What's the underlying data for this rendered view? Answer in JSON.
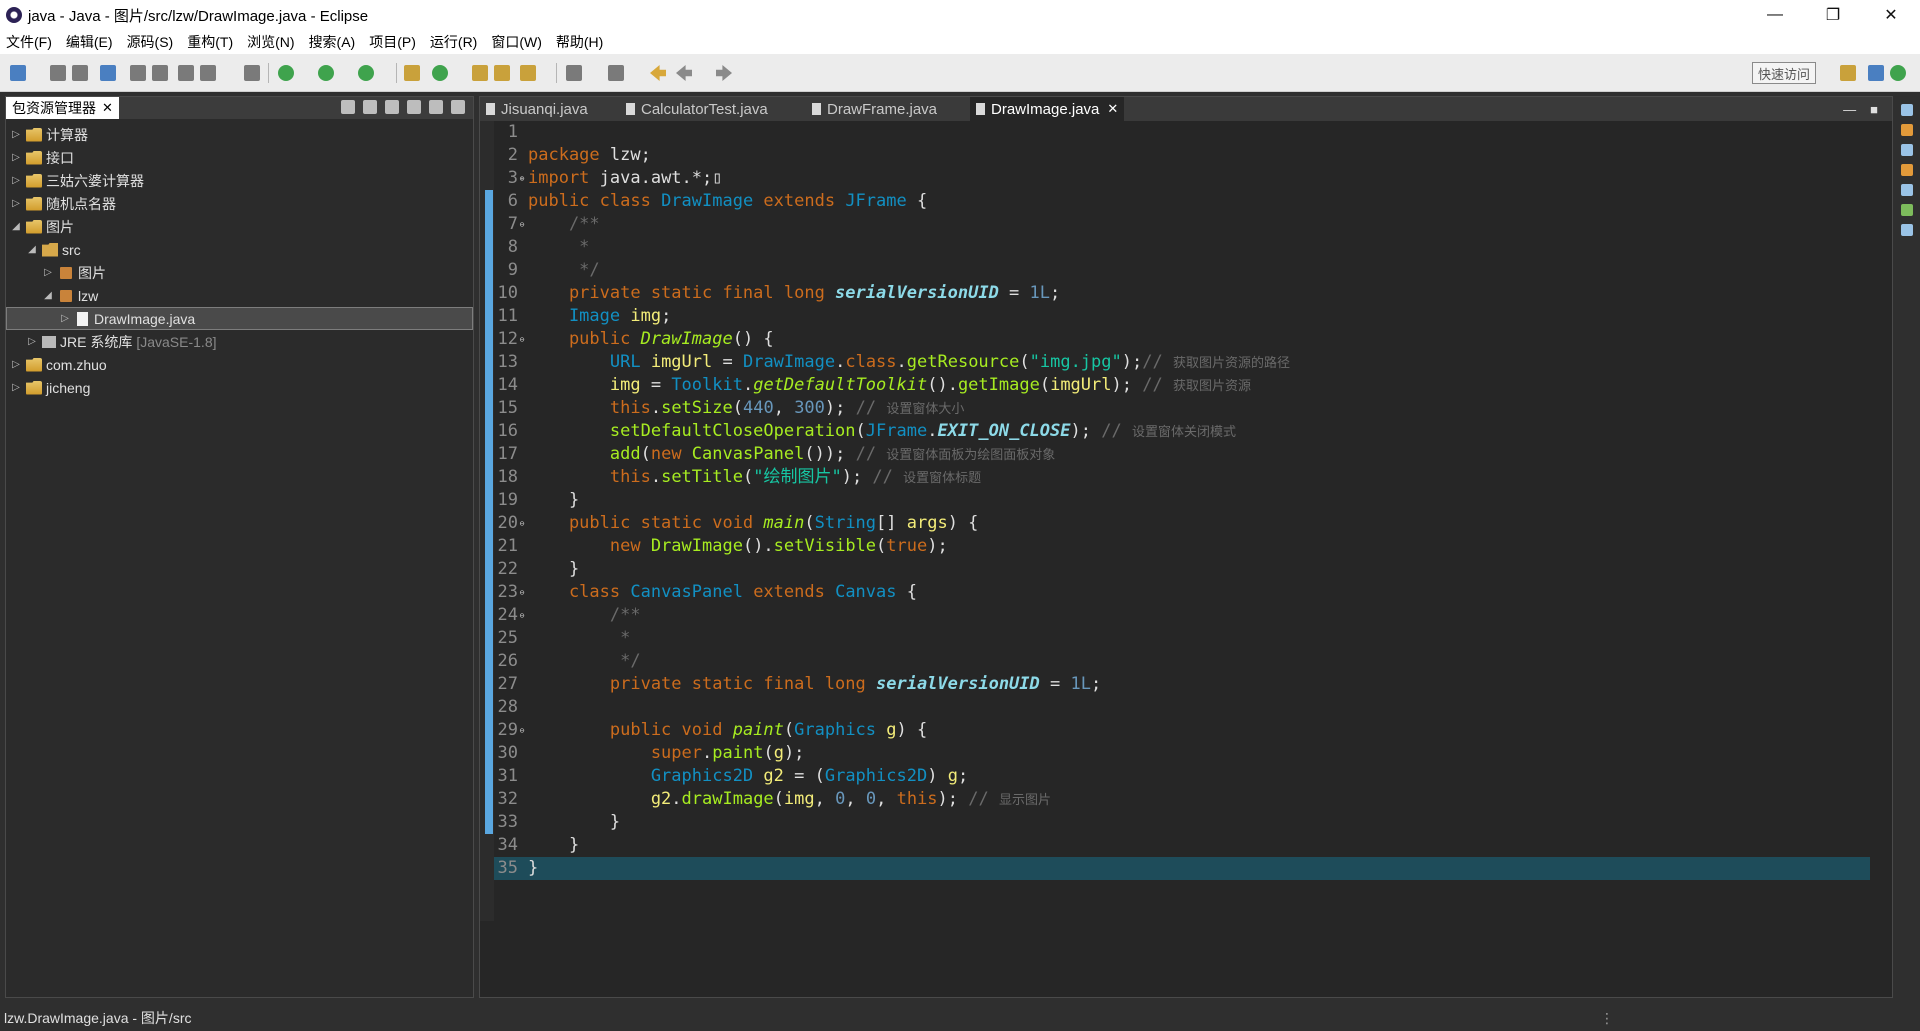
{
  "window": {
    "title": "java - Java - 图片/src/lzw/DrawImage.java - Eclipse",
    "minimize": "—",
    "restore": "❐",
    "close": "✕"
  },
  "menu": [
    "文件(F)",
    "编辑(E)",
    "源码(S)",
    "重构(T)",
    "浏览(N)",
    "搜索(A)",
    "项目(P)",
    "运行(R)",
    "窗口(W)",
    "帮助(H)"
  ],
  "toolbar": {
    "quick_access": "快速访问"
  },
  "package_explorer": {
    "title": "包资源管理器",
    "close": "✕",
    "items": [
      {
        "label": "计算器",
        "depth": 0,
        "arrow": "▷",
        "icon": "project-icon",
        "extra": ""
      },
      {
        "label": "接口",
        "depth": 0,
        "arrow": "▷",
        "icon": "project-icon",
        "extra": ""
      },
      {
        "label": "三姑六婆计算器",
        "depth": 0,
        "arrow": "▷",
        "icon": "project-icon",
        "extra": ""
      },
      {
        "label": "随机点名器",
        "depth": 0,
        "arrow": "▷",
        "icon": "project-icon",
        "extra": ""
      },
      {
        "label": "图片",
        "depth": 0,
        "arrow": "◢",
        "icon": "project-icon",
        "extra": ""
      },
      {
        "label": "src",
        "depth": 1,
        "arrow": "◢",
        "icon": "folder-icon",
        "extra": ""
      },
      {
        "label": "图片",
        "depth": 2,
        "arrow": "▷",
        "icon": "package-icon",
        "extra": ""
      },
      {
        "label": "lzw",
        "depth": 2,
        "arrow": "◢",
        "icon": "package-icon",
        "extra": ""
      },
      {
        "label": "DrawImage.java",
        "depth": 3,
        "arrow": "▷",
        "icon": "java-file-icon",
        "extra": "",
        "selected": true
      },
      {
        "label": "JRE 系统库",
        "depth": 1,
        "arrow": "▷",
        "icon": "library-icon",
        "extra": "[JavaSE-1.8]"
      },
      {
        "label": "com.zhuo",
        "depth": 0,
        "arrow": "▷",
        "icon": "project-icon",
        "extra": ""
      },
      {
        "label": "jicheng",
        "depth": 0,
        "arrow": "▷",
        "icon": "project-icon",
        "extra": ""
      }
    ]
  },
  "editor": {
    "tabs": [
      "Jisuanqi.java",
      "CalculatorTest.java",
      "DrawFrame.java",
      "DrawImage.java"
    ],
    "active_tab_close": "✕",
    "controls": [
      "—",
      "■"
    ],
    "code": [
      {
        "n": "1",
        "fold": "",
        "t": []
      },
      {
        "n": "2",
        "fold": "",
        "t": [
          [
            "kw",
            "package "
          ],
          [
            "txt",
            "lzw;"
          ]
        ]
      },
      {
        "n": "3",
        "fold": "⊕",
        "t": [
          [
            "kw",
            "import "
          ],
          [
            "txt",
            "java.awt.*;"
          ],
          [
            "txt",
            "▯"
          ]
        ]
      },
      {
        "n": "6",
        "fold": "",
        "t": [
          [
            "kw",
            "public class "
          ],
          [
            "ty",
            "DrawImage "
          ],
          [
            "kw",
            "extends "
          ],
          [
            "ty",
            "JFrame "
          ],
          [
            "txt",
            "{"
          ]
        ]
      },
      {
        "n": "7",
        "fold": "⊖",
        "t": [
          [
            "cm",
            "    /**"
          ]
        ]
      },
      {
        "n": "8",
        "fold": "",
        "t": [
          [
            "cm",
            "     *"
          ]
        ]
      },
      {
        "n": "9",
        "fold": "",
        "t": [
          [
            "cm",
            "     */"
          ]
        ]
      },
      {
        "n": "10",
        "fold": "",
        "t": [
          [
            "kw",
            "    private static final long "
          ],
          [
            "ci",
            "serialVersionUID"
          ],
          [
            "txt",
            " = "
          ],
          [
            "num",
            "1L"
          ],
          [
            "txt",
            ";"
          ]
        ]
      },
      {
        "n": "11",
        "fold": "",
        "t": [
          [
            "ty",
            "    Image "
          ],
          [
            "loc",
            "img"
          ],
          [
            "txt",
            ";"
          ]
        ]
      },
      {
        "n": "12",
        "fold": "⊖",
        "t": [
          [
            "kw",
            "    public "
          ],
          [
            "fni",
            "DrawImage"
          ],
          [
            "txt",
            "() {"
          ]
        ]
      },
      {
        "n": "13",
        "fold": "",
        "t": [
          [
            "ty",
            "        URL "
          ],
          [
            "loc",
            "imgUrl"
          ],
          [
            "txt",
            " = "
          ],
          [
            "ty",
            "DrawImage"
          ],
          [
            "txt",
            "."
          ],
          [
            "kw",
            "class"
          ],
          [
            "txt",
            "."
          ],
          [
            "fn",
            "getResource"
          ],
          [
            "txt",
            "("
          ],
          [
            "st",
            "\"img.jpg\""
          ],
          [
            "txt",
            ");"
          ],
          [
            "cm",
            "// "
          ],
          [
            "cmt",
            "获取图片资源的路径"
          ]
        ]
      },
      {
        "n": "14",
        "fold": "",
        "t": [
          [
            "loc",
            "        img"
          ],
          [
            "txt",
            " = "
          ],
          [
            "ty",
            "Toolkit"
          ],
          [
            "txt",
            "."
          ],
          [
            "fni",
            "getDefaultToolkit"
          ],
          [
            "txt",
            "()."
          ],
          [
            "fn",
            "getImage"
          ],
          [
            "txt",
            "("
          ],
          [
            "loc",
            "imgUrl"
          ],
          [
            "txt",
            "); "
          ],
          [
            "cm",
            "// "
          ],
          [
            "cmt",
            "获取图片资源"
          ]
        ]
      },
      {
        "n": "15",
        "fold": "",
        "t": [
          [
            "kw",
            "        this"
          ],
          [
            "txt",
            "."
          ],
          [
            "fn",
            "setSize"
          ],
          [
            "txt",
            "("
          ],
          [
            "num",
            "440"
          ],
          [
            "txt",
            ", "
          ],
          [
            "num",
            "300"
          ],
          [
            "txt",
            "); "
          ],
          [
            "cm",
            "// "
          ],
          [
            "cmt",
            "设置窗体大小"
          ]
        ]
      },
      {
        "n": "16",
        "fold": "",
        "t": [
          [
            "fn",
            "        setDefaultCloseOperation"
          ],
          [
            "txt",
            "("
          ],
          [
            "ty",
            "JFrame"
          ],
          [
            "txt",
            "."
          ],
          [
            "ci",
            "EXIT_ON_CLOSE"
          ],
          [
            "txt",
            "); "
          ],
          [
            "cm",
            "// "
          ],
          [
            "cmt",
            "设置窗体关闭模式"
          ]
        ]
      },
      {
        "n": "17",
        "fold": "",
        "t": [
          [
            "fn",
            "        add"
          ],
          [
            "txt",
            "("
          ],
          [
            "kw",
            "new "
          ],
          [
            "fn",
            "CanvasPanel"
          ],
          [
            "txt",
            "()); "
          ],
          [
            "cm",
            "// "
          ],
          [
            "cmt",
            "设置窗体面板为绘图面板对象"
          ]
        ]
      },
      {
        "n": "18",
        "fold": "",
        "t": [
          [
            "kw",
            "        this"
          ],
          [
            "txt",
            "."
          ],
          [
            "fn",
            "setTitle"
          ],
          [
            "txt",
            "("
          ],
          [
            "st",
            "\"绘制图片\""
          ],
          [
            "txt",
            "); "
          ],
          [
            "cm",
            "// "
          ],
          [
            "cmt",
            "设置窗体标题"
          ]
        ]
      },
      {
        "n": "19",
        "fold": "",
        "t": [
          [
            "txt",
            "    }"
          ]
        ]
      },
      {
        "n": "20",
        "fold": "⊖",
        "t": [
          [
            "kw",
            "    public static void "
          ],
          [
            "fni",
            "main"
          ],
          [
            "txt",
            "("
          ],
          [
            "ty",
            "String"
          ],
          [
            "txt",
            "[] "
          ],
          [
            "loc",
            "args"
          ],
          [
            "txt",
            ") {"
          ]
        ]
      },
      {
        "n": "21",
        "fold": "",
        "t": [
          [
            "kw",
            "        new "
          ],
          [
            "fn",
            "DrawImage"
          ],
          [
            "txt",
            "()."
          ],
          [
            "fn",
            "setVisible"
          ],
          [
            "txt",
            "("
          ],
          [
            "kw",
            "true"
          ],
          [
            "txt",
            ");"
          ]
        ]
      },
      {
        "n": "22",
        "fold": "",
        "t": [
          [
            "txt",
            "    }"
          ]
        ]
      },
      {
        "n": "23",
        "fold": "⊖",
        "t": [
          [
            "kw",
            "    class "
          ],
          [
            "ty",
            "CanvasPanel "
          ],
          [
            "kw",
            "extends "
          ],
          [
            "ty",
            "Canvas "
          ],
          [
            "txt",
            "{"
          ]
        ]
      },
      {
        "n": "24",
        "fold": "⊖",
        "t": [
          [
            "cm",
            "        /**"
          ]
        ]
      },
      {
        "n": "25",
        "fold": "",
        "t": [
          [
            "cm",
            "         *"
          ]
        ]
      },
      {
        "n": "26",
        "fold": "",
        "t": [
          [
            "cm",
            "         */"
          ]
        ]
      },
      {
        "n": "27",
        "fold": "",
        "t": [
          [
            "kw",
            "        private static final long "
          ],
          [
            "ci",
            "serialVersionUID"
          ],
          [
            "txt",
            " = "
          ],
          [
            "num",
            "1L"
          ],
          [
            "txt",
            ";"
          ]
        ]
      },
      {
        "n": "28",
        "fold": "",
        "t": []
      },
      {
        "n": "29",
        "fold": "⊖",
        "t": [
          [
            "kw",
            "        public void "
          ],
          [
            "fni",
            "paint"
          ],
          [
            "txt",
            "("
          ],
          [
            "ty",
            "Graphics "
          ],
          [
            "loc",
            "g"
          ],
          [
            "txt",
            ") {"
          ]
        ]
      },
      {
        "n": "30",
        "fold": "",
        "t": [
          [
            "kw",
            "            super"
          ],
          [
            "txt",
            "."
          ],
          [
            "fn",
            "paint"
          ],
          [
            "txt",
            "("
          ],
          [
            "loc",
            "g"
          ],
          [
            "txt",
            ");"
          ]
        ]
      },
      {
        "n": "31",
        "fold": "",
        "t": [
          [
            "ty",
            "            Graphics2D "
          ],
          [
            "loc",
            "g2"
          ],
          [
            "txt",
            " = ("
          ],
          [
            "ty",
            "Graphics2D"
          ],
          [
            "txt",
            ") "
          ],
          [
            "loc",
            "g"
          ],
          [
            "txt",
            ";"
          ]
        ]
      },
      {
        "n": "32",
        "fold": "",
        "t": [
          [
            "loc",
            "            g2"
          ],
          [
            "txt",
            "."
          ],
          [
            "fn",
            "drawImage"
          ],
          [
            "txt",
            "("
          ],
          [
            "loc",
            "img"
          ],
          [
            "txt",
            ", "
          ],
          [
            "num",
            "0"
          ],
          [
            "txt",
            ", "
          ],
          [
            "num",
            "0"
          ],
          [
            "txt",
            ", "
          ],
          [
            "kw",
            "this"
          ],
          [
            "txt",
            "); "
          ],
          [
            "cm",
            "// "
          ],
          [
            "cmt",
            "显示图片"
          ]
        ]
      },
      {
        "n": "33",
        "fold": "",
        "t": [
          [
            "txt",
            "        }"
          ]
        ]
      },
      {
        "n": "34",
        "fold": "",
        "t": [
          [
            "txt",
            "    }"
          ]
        ]
      },
      {
        "n": "35",
        "fold": "",
        "t": [
          [
            "txt",
            "}"
          ]
        ],
        "current": true
      }
    ]
  },
  "status": {
    "text": "lzw.DrawImage.java - 图片/src"
  }
}
